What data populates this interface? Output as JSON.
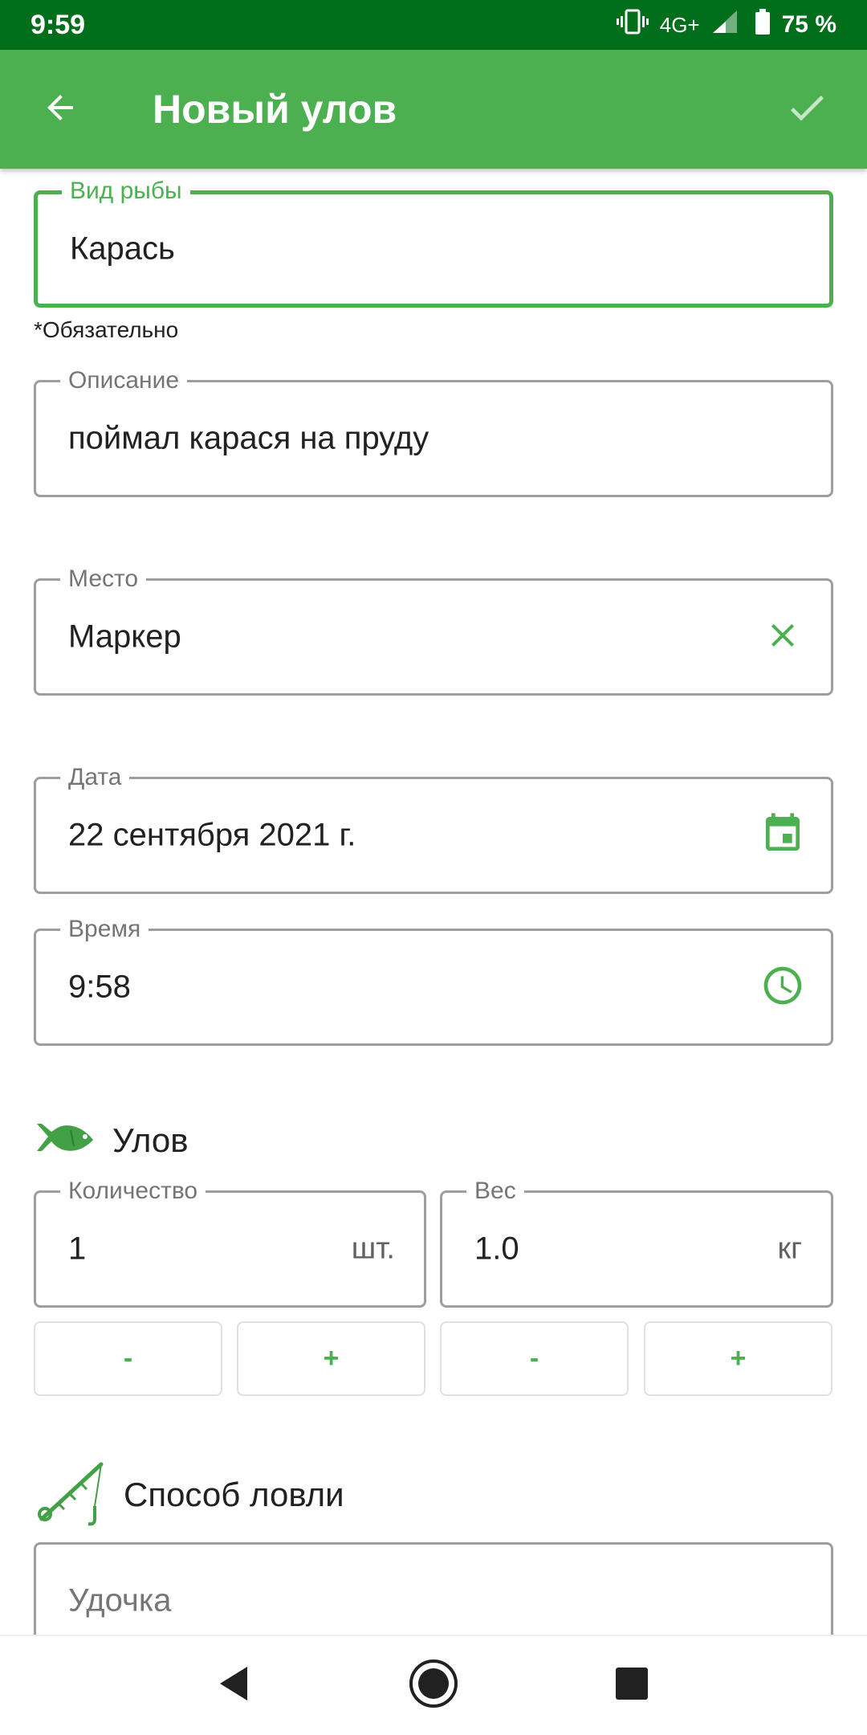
{
  "status_bar": {
    "time": "9:59",
    "network": "4G+",
    "battery": "75 %"
  },
  "app_bar": {
    "title": "Новый улов"
  },
  "fields": {
    "fish_type": {
      "label": "Вид рыбы",
      "value": "Карась",
      "helper": "*Обязательно"
    },
    "description": {
      "label": "Описание",
      "value": "поймал карася на пруду"
    },
    "place": {
      "label": "Место",
      "value": "Маркер"
    },
    "date": {
      "label": "Дата",
      "value": "22 сентября 2021 г."
    },
    "time": {
      "label": "Время",
      "value": "9:58"
    }
  },
  "catch_section": {
    "title": "Улов",
    "quantity": {
      "label": "Количество",
      "value": "1",
      "unit": "шт."
    },
    "weight": {
      "label": "Вес",
      "value": "1.0",
      "unit": "кг"
    },
    "minus_label": "-",
    "plus_label": "+"
  },
  "method_section": {
    "title": "Способ ловли",
    "placeholder": "Удочка"
  },
  "colors": {
    "accent": "#4caf50",
    "status_bar": "#006e1a",
    "outline": "#9e9e9e"
  },
  "icons": [
    "back-arrow-icon",
    "check-icon",
    "clear-icon",
    "calendar-icon",
    "clock-icon",
    "fish-icon",
    "fishing-rod-icon",
    "nav-back-icon",
    "nav-home-icon",
    "nav-recents-icon"
  ]
}
